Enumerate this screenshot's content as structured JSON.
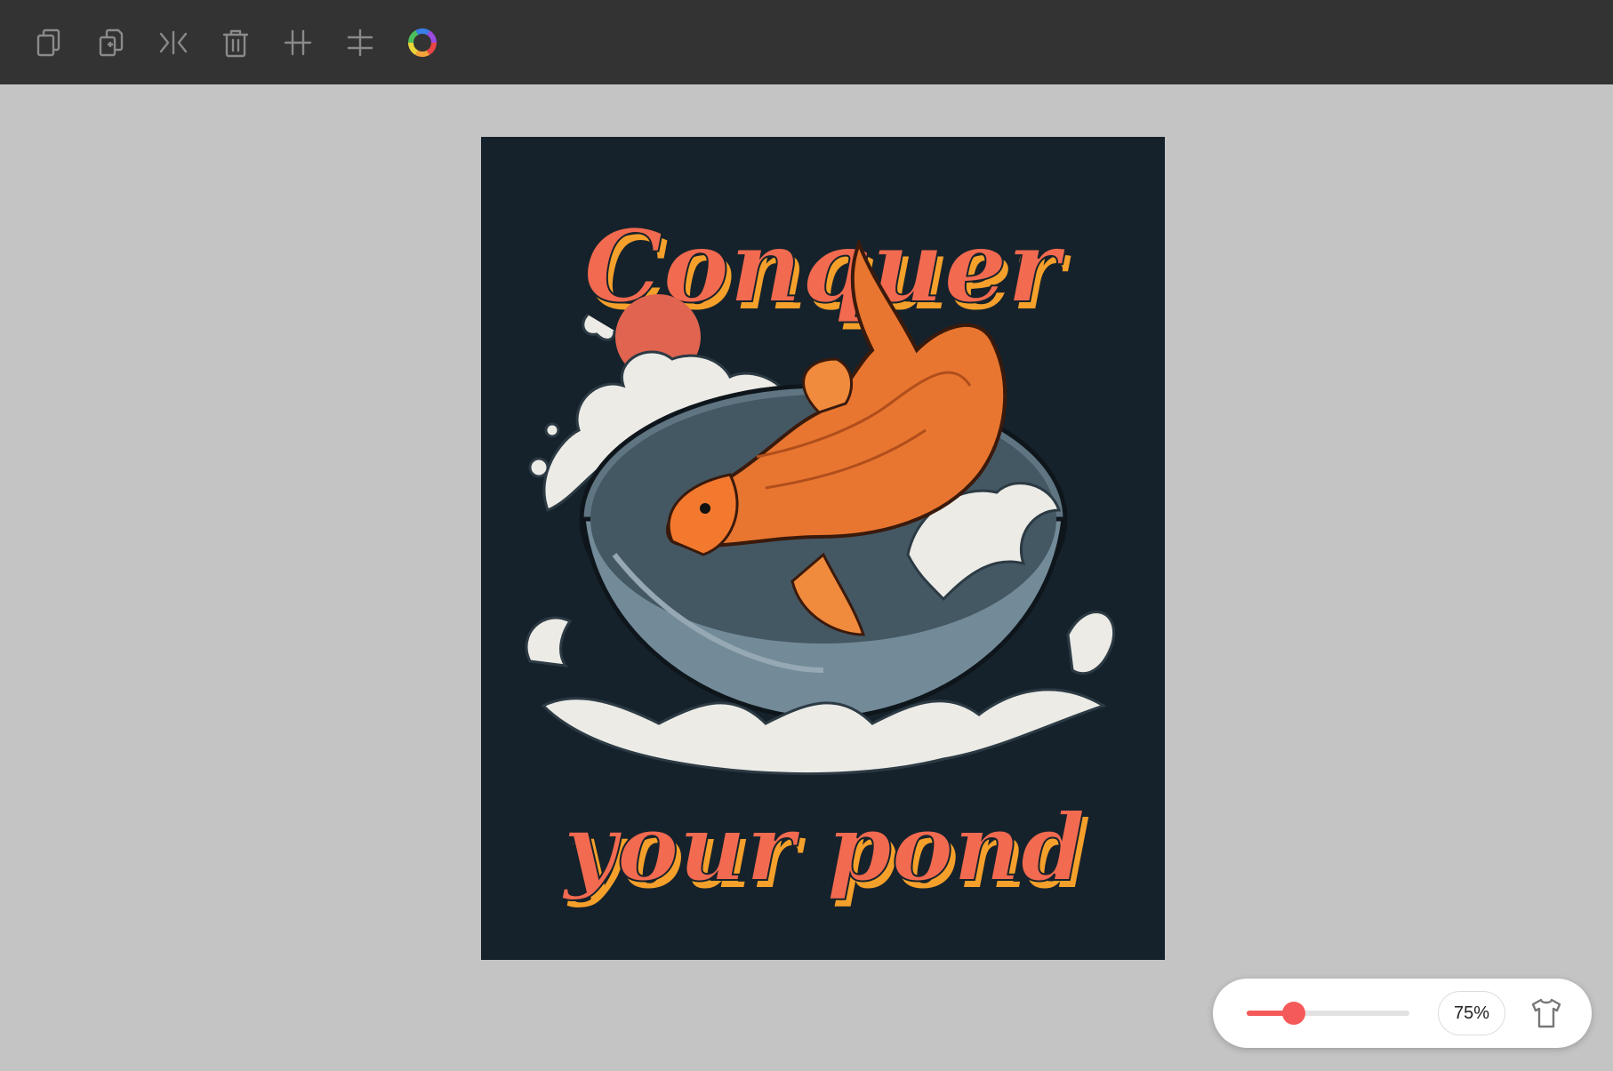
{
  "toolbar": {
    "tools": [
      {
        "name": "duplicate-icon",
        "interactable": true
      },
      {
        "name": "copy-layer-icon",
        "interactable": true
      },
      {
        "name": "flip-horizontal-icon",
        "interactable": true
      },
      {
        "name": "trash-icon",
        "interactable": true
      },
      {
        "name": "align-center-vertical-icon",
        "interactable": true
      },
      {
        "name": "align-center-horizontal-icon",
        "interactable": true
      },
      {
        "name": "color-wheel-icon",
        "interactable": true
      }
    ],
    "icon_color": "#8a8a8a"
  },
  "artboard": {
    "background_color": "#16222b",
    "text_top": "Conquer",
    "text_bottom": "your pond",
    "text_color": "#f26a50",
    "text_shadow_color": "#f5a02b"
  },
  "zoom": {
    "level_label": "75%",
    "level_fraction": 0.29,
    "accent_color": "#f55a5a"
  },
  "shirt_icon": "tshirt-icon"
}
